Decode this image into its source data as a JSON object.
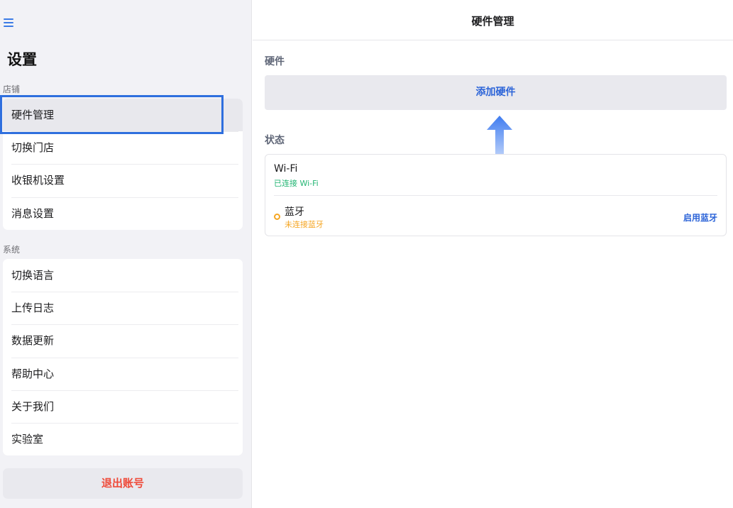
{
  "sidebar": {
    "title": "设置",
    "menu_icon": "hamburger-menu-icon",
    "store_section": {
      "label": "店铺",
      "items": [
        {
          "label": "硬件管理",
          "selected": true
        },
        {
          "label": "切换门店"
        },
        {
          "label": "收银机设置"
        },
        {
          "label": "消息设置"
        }
      ]
    },
    "system_section": {
      "label": "系统",
      "items": [
        {
          "label": "切换语言"
        },
        {
          "label": "上传日志"
        },
        {
          "label": "数据更新"
        },
        {
          "label": "帮助中心"
        },
        {
          "label": "关于我们"
        },
        {
          "label": "实验室"
        }
      ]
    },
    "logout_label": "退出账号"
  },
  "main": {
    "title": "硬件管理",
    "hardware_section_label": "硬件",
    "add_hardware_label": "添加硬件",
    "status_section_label": "状态",
    "wifi": {
      "name": "Wi-Fi",
      "status": "已连接 Wi-Fi"
    },
    "bluetooth": {
      "name": "蓝牙",
      "status": "未连接蓝牙",
      "action": "启用蓝牙"
    }
  },
  "colors": {
    "accent": "#2c64d8",
    "selection_border": "#2f6fde",
    "danger": "#ef4b3a",
    "connected": "#22b573",
    "warning": "#f5a623"
  }
}
